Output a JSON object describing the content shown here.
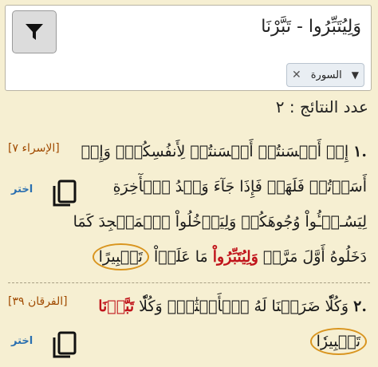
{
  "search": {
    "query": "وَلِيُتَبِّرُوا - تَبَّرْنَا"
  },
  "filter_chip": {
    "label": "السورة"
  },
  "results_count": "عدد النتائج : ٢",
  "results": [
    {
      "number": ".١",
      "ref": "[الإسراء ٧]",
      "choose": "اختر",
      "text_a": "إِنۡ أَحۡسَنتُمۡ أَحۡسَنتُمۡ لِأَنفُسِكُمۡۖ وَإِنۡ أَسَأۡتُمۡ فَلَهَاۚ فَإِذَا جَآءَ وَعۡدُ ٱلۡأٓخِرَةِ لِيَسُـۥٓـُٔواْ وُجُوهَكُمۡ وَلِيَدۡخُلُواْ ٱلۡمَسۡجِدَ كَمَا دَخَلُوهُ أَوَّلَ مَرَّةٖ",
      "highlight": "وَلِيُتَبِّرُواْ",
      "text_b": "مَا عَلَوۡاْ",
      "circled": "تَتۡبِيرًا"
    },
    {
      "number": ".٢",
      "ref": "[الفرقان ٣٩]",
      "choose": "اختر",
      "text_a": "وَكُلّٗا ضَرَبۡنَا لَهُ ٱلۡأَمۡثَٰلَۖ وَكُلّٗا",
      "highlight": "تَبَّرۡنَا",
      "text_b": "",
      "circled": "تَتۡبِيرٗا"
    }
  ]
}
